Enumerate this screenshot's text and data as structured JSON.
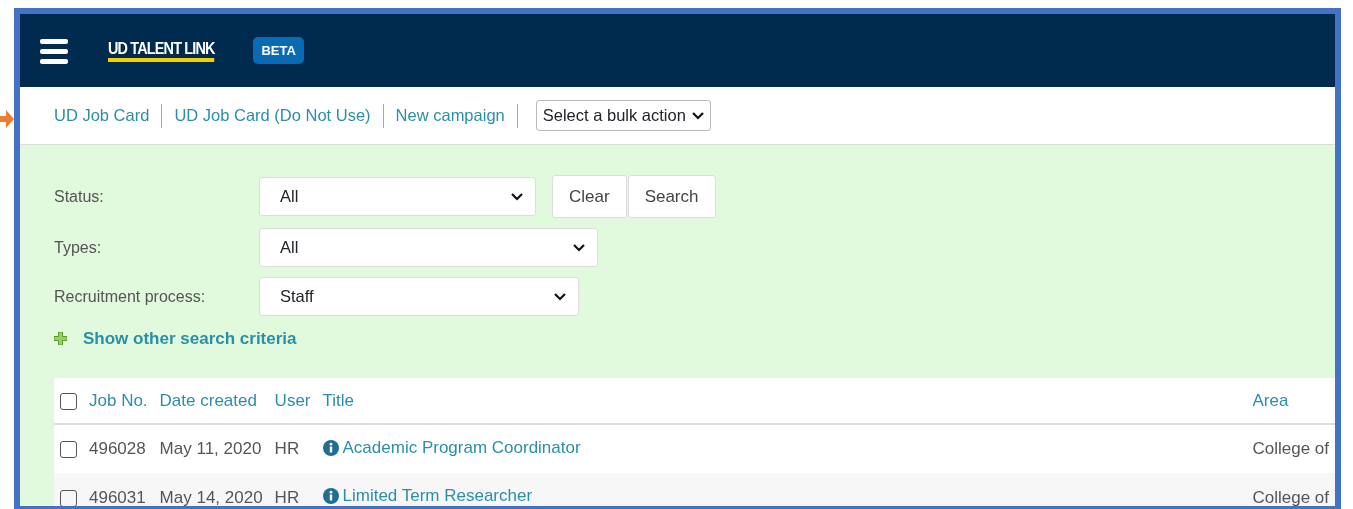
{
  "header": {
    "logo": "UD TALENT LINK",
    "badge": "BETA"
  },
  "actions": {
    "links": [
      "UD Job Card",
      "UD Job Card (Do Not Use)",
      "New campaign"
    ],
    "bulk_select": "Select a bulk action"
  },
  "filters": [
    {
      "label": "Status:",
      "value": "All",
      "buttons": [
        "Clear",
        "Search"
      ]
    },
    {
      "label": "Types:",
      "value": "All"
    },
    {
      "label": "Recruitment process:",
      "value": "Staff"
    }
  ],
  "more_criteria": "Show other search criteria",
  "table": {
    "select_all": {
      "checked": false
    },
    "columns": [
      "Job No.",
      "Date created",
      "User",
      "Title",
      "Area"
    ],
    "rows": [
      {
        "checked": false,
        "job_no": "496028",
        "date": "May 11, 2020",
        "user": "HR",
        "title": "Academic Program Coordinator",
        "area": "College of"
      },
      {
        "checked": false,
        "job_no": "496031",
        "date": "May 14, 2020",
        "user": "HR",
        "title": "Limited Term Researcher",
        "area": "College of"
      }
    ]
  }
}
